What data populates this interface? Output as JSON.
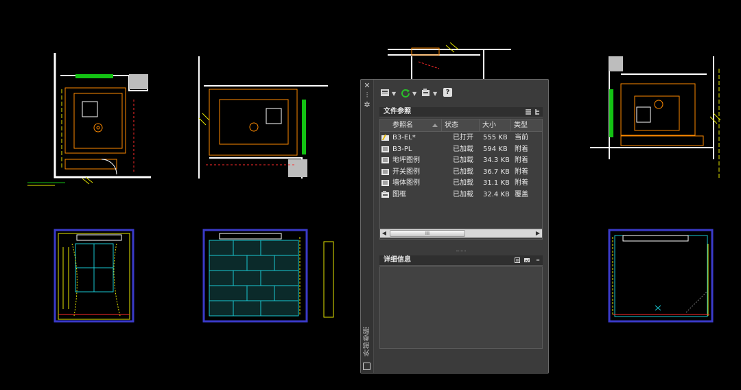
{
  "palette": {
    "vertical_title": "外部参照",
    "close_glyph": "✕",
    "pin_glyph": "⫶",
    "settings_glyph": "✲",
    "toolbar": {
      "attach_icon": "attach-dwg-icon",
      "refresh_icon": "refresh-icon",
      "change_path_icon": "change-path-icon",
      "help_icon": "help-icon",
      "help_glyph": "?",
      "caret": "▼"
    },
    "file_refs": {
      "title": "文件参照",
      "list_view_icon": "list-view-icon",
      "tree_view_icon": "tree-view-icon",
      "columns": [
        "参照名",
        "状态",
        "大小",
        "类型"
      ],
      "rows": [
        {
          "name": "B3-EL*",
          "status": "已打开",
          "size": "555 KB",
          "type": "当前",
          "icon": "current-drawing-icon"
        },
        {
          "name": "B3-PL",
          "status": "已加载",
          "size": "594 KB",
          "type": "附着",
          "icon": "dwg-reference-icon"
        },
        {
          "name": "地坪图例",
          "status": "已加载",
          "size": "34.3 KB",
          "type": "附着",
          "icon": "dwg-reference-icon"
        },
        {
          "name": "开关图例",
          "status": "已加载",
          "size": "36.7 KB",
          "type": "附着",
          "icon": "dwg-reference-icon"
        },
        {
          "name": "墙体图例",
          "status": "已加载",
          "size": "31.1 KB",
          "type": "附着",
          "icon": "dwg-reference-icon"
        },
        {
          "name": "图框",
          "status": "已加载",
          "size": "32.4 KB",
          "type": "覆盖",
          "icon": "overlay-reference-icon"
        }
      ],
      "scroll_thumb_grip": "III",
      "scroll_left": "◀",
      "scroll_right": "▶"
    },
    "details": {
      "title": "详细信息",
      "collapse_glyph": "–"
    }
  },
  "colors": {
    "background": "#000000",
    "palette_bg": "#3b3b3b",
    "wall": "#ffffff",
    "furniture": "#ff8a00",
    "annotation": "#ff2a2a",
    "green": "#13c213",
    "yellow": "#e6e600",
    "cyan": "#19c8d2",
    "frame_blue": "#3a3ac8"
  }
}
